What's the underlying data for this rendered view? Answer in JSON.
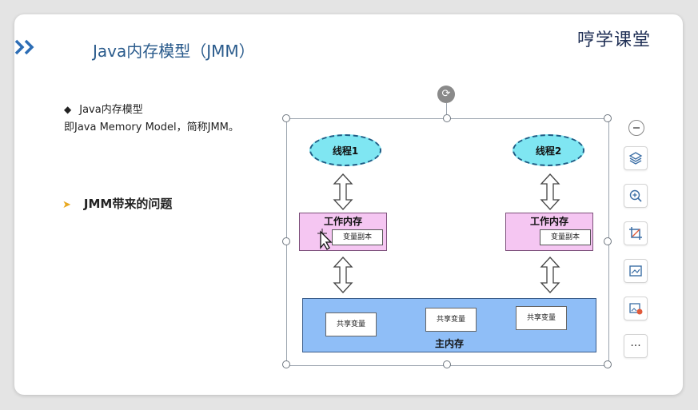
{
  "slide": {
    "title": "Java内存模型（JMM）",
    "logo_text": "学课堂",
    "logo_prefix": "哼",
    "bullet1": "Java内存模型",
    "bullet1_sub": "即Java Memory Model，简称JMM。",
    "bullet2": "JMM带来的问题"
  },
  "diagram": {
    "thread1": "线程1",
    "thread2": "线程2",
    "work_mem_1": "工作内存",
    "work_mem_2": "工作内存",
    "copy_1": "变量副本",
    "copy_2": "变量副本",
    "shared_1": "共享变量",
    "shared_2": "共享变量",
    "shared_3": "共享变量",
    "main_mem": "主内存"
  },
  "toolbar": {
    "more": "···"
  },
  "colors": {
    "title": "#2a5b8c",
    "thread_fill": "#7fe6f2",
    "work_fill": "#f5c6f2",
    "main_fill": "#8fbef7",
    "accent_arrow": "#e8a820",
    "chevron": "#2c6db5"
  },
  "icons": [
    "double-chevron-icon",
    "rotate-icon",
    "zoom-out-icon",
    "layers-icon",
    "zoom-in-icon",
    "crop-icon",
    "image-frame-icon",
    "image-edit-icon",
    "more-icon",
    "cursor-icon"
  ]
}
